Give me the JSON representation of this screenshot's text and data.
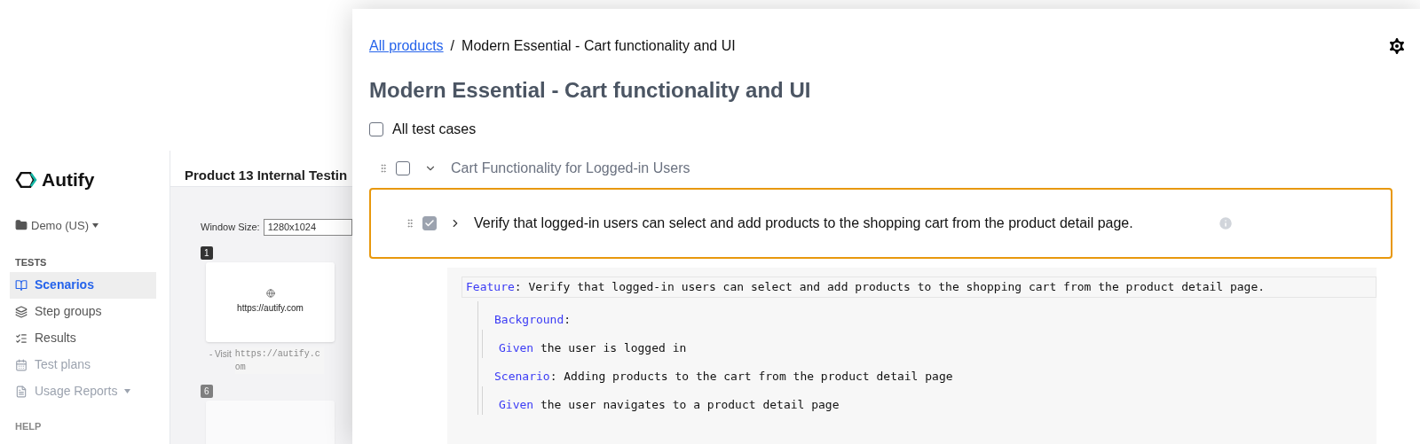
{
  "back_app": {
    "logo": "Autify",
    "workspace": "Demo (US)",
    "sections": [
      {
        "heading": "TESTS",
        "items": [
          {
            "label": "Scenarios",
            "selected": true,
            "has_caret": false
          },
          {
            "label": "Step groups",
            "selected": false,
            "has_caret": false
          },
          {
            "label": "Results",
            "selected": false,
            "has_caret": false
          },
          {
            "label": "Test plans",
            "selected": false,
            "has_caret": false
          },
          {
            "label": "Usage Reports",
            "selected": false,
            "has_caret": true
          }
        ]
      },
      {
        "heading": "HELP"
      }
    ],
    "page_title": "Product 13 Internal Testin",
    "window_size_label": "Window Size:",
    "window_size_value": "1280x1024",
    "steps": [
      {
        "number": "1",
        "url": "https://autify.com",
        "caption": "- Visit",
        "caption_code": "https://autify.com"
      },
      {
        "number": "6"
      }
    ]
  },
  "panel": {
    "breadcrumb": {
      "link": "All products",
      "separator": "/",
      "current": "Modern Essential - Cart functionality and UI"
    },
    "title": "Modern Essential - Cart functionality and UI",
    "all_cases": {
      "label": "All test cases",
      "checked": false
    },
    "group": {
      "label": "Cart Functionality for Logged-in Users",
      "checked": false,
      "expanded": true
    },
    "case": {
      "text": "Verify that logged-in users can select and add products to the shopping cart from the product detail page.",
      "checked": true,
      "expanded": false,
      "selected": true
    },
    "gherkin": [
      {
        "keyword": "Feature",
        "text": ": Verify that logged-in users can select and add products to the shopping cart from the product detail page.",
        "children": [
          {
            "keyword": "Background",
            "text": ":",
            "children": [
              {
                "keyword": "Given",
                "text": " the user is logged in"
              }
            ]
          },
          {
            "keyword": "Scenario",
            "text": ": Adding products to the cart from the product detail page",
            "children": [
              {
                "keyword": "Given",
                "text": " the user navigates to a product detail page"
              }
            ]
          }
        ]
      }
    ]
  }
}
